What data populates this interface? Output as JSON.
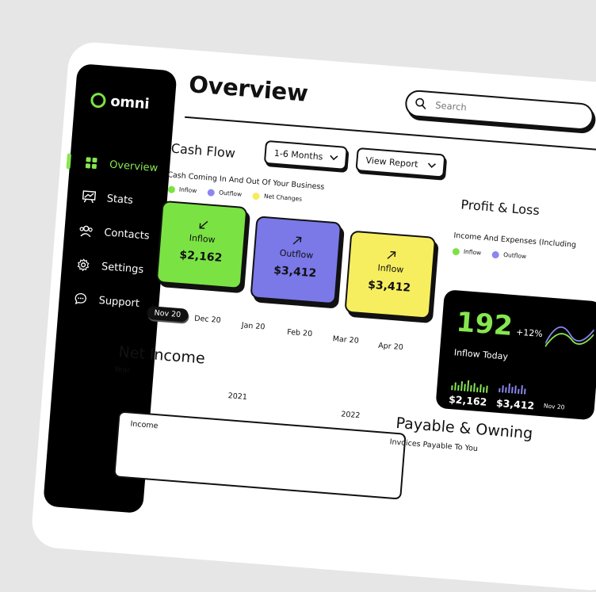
{
  "brand": {
    "name": "omni",
    "accent": "#86e64f"
  },
  "sidebar": {
    "items": [
      {
        "label": "Overview",
        "icon": "grid-icon",
        "active": true
      },
      {
        "label": "Stats",
        "icon": "chart-board-icon",
        "active": false
      },
      {
        "label": "Contacts",
        "icon": "people-icon",
        "active": false
      },
      {
        "label": "Settings",
        "icon": "gear-icon",
        "active": false
      },
      {
        "label": "Support",
        "icon": "chat-bubble-icon",
        "active": false
      }
    ]
  },
  "header": {
    "title": "Overview",
    "search_placeholder": "Search"
  },
  "cashflow": {
    "title": "Cash Flow",
    "range_select": "1-6 Months",
    "report_select": "View Report",
    "subtitle": "Cash Coming In And Out Of Your Business",
    "legend": [
      {
        "label": "Inflow",
        "color": "#7be244"
      },
      {
        "label": "Outflow",
        "color": "#8b86f0"
      },
      {
        "label": "Net Changes",
        "color": "#f6ec5a"
      }
    ],
    "cards": [
      {
        "label": "Inflow",
        "value": "$2,162",
        "arrow": "arrow-down-left-icon",
        "color": "#7be244"
      },
      {
        "label": "Outflow",
        "value": "$3,412",
        "arrow": "arrow-up-right-icon",
        "color": "#7b78e8"
      },
      {
        "label": "Inflow",
        "value": "$3,412",
        "arrow": "arrow-up-right-icon",
        "color": "#f7ee5f"
      }
    ],
    "months": [
      "Nov 20",
      "Dec 20",
      "Jan 20",
      "Feb 20",
      "Mar 20",
      "Apr 20"
    ],
    "selected_month": "Nov 20"
  },
  "profit_loss": {
    "title": "Profit & Loss",
    "subtitle": "Income And Expenses (Including",
    "legend": [
      {
        "label": "Inflow",
        "color": "#7be244"
      },
      {
        "label": "Outflow",
        "color": "#8b86f0"
      }
    ],
    "big_number": "192",
    "change": "+12%",
    "caption": "Inflow Today",
    "inflow_value": "$2,162",
    "outflow_value": "$3,412",
    "axis_label": "Nov 20"
  },
  "net_income": {
    "title": "Net Income",
    "year_label": "Year",
    "years": [
      "2021",
      "2022"
    ],
    "row_label": "Income"
  },
  "payable": {
    "title": "Payable & Owning",
    "subtitle": "Invoices Payable To You"
  }
}
